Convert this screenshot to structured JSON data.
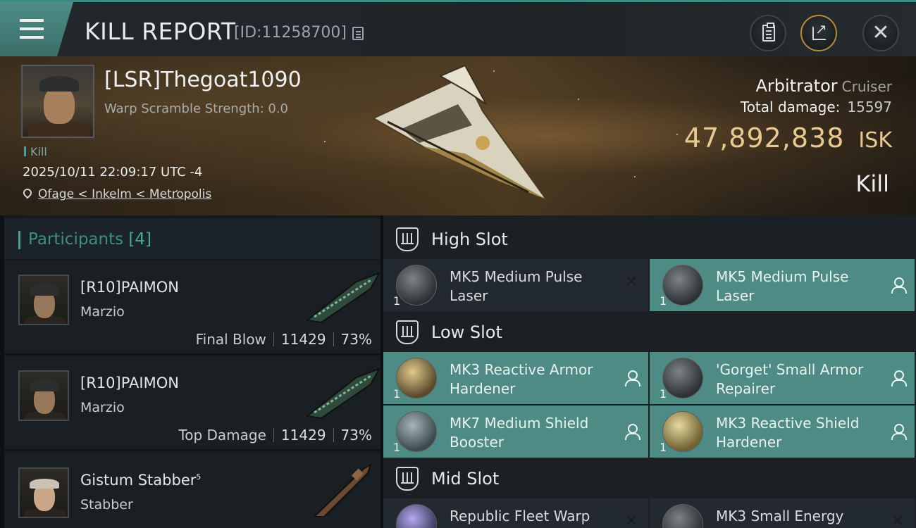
{
  "header": {
    "title": "KILL REPORT",
    "report_id": "[ID:11258700]",
    "icons": {
      "menu": "menu-icon",
      "copy": "copy-icon",
      "clipboard": "clipboard-icon",
      "share": "share-icon",
      "close": "close-icon"
    }
  },
  "victim": {
    "pilot": "[LSR]Thegoat1090",
    "warp_scramble": "Warp Scramble Strength: 0.0",
    "tag": "Kill",
    "datetime": "2025/10/11 22:09:17 UTC -4",
    "location": "Ofage < Inkelm < Metropolis",
    "ship": "Arbitrator",
    "ship_class": "Cruiser",
    "total_damage_label": "Total damage:",
    "total_damage": "15597",
    "isk_value": "47,892,838",
    "isk_unit": "ISK",
    "result": "Kill"
  },
  "participants": {
    "title": "Participants",
    "count": "[4]",
    "items": [
      {
        "name": "[R10]PAIMON",
        "ship": "Marzio",
        "label": "Final Blow",
        "damage": "11429",
        "percent": "73%"
      },
      {
        "name": "[R10]PAIMON",
        "ship": "Marzio",
        "label": "Top Damage",
        "damage": "11429",
        "percent": "73%"
      },
      {
        "name": "Gistum Stabber",
        "name_sup": "5",
        "ship": "Stabber"
      }
    ]
  },
  "slots": {
    "high": {
      "title": "High Slot",
      "modules": [
        {
          "name": "MK5 Medium Pulse Laser",
          "qty": "1",
          "status": "destroyed"
        },
        {
          "name": "MK5 Medium Pulse Laser",
          "qty": "1",
          "status": "dropped"
        }
      ]
    },
    "low": {
      "title": "Low Slot",
      "modules": [
        {
          "name": "MK3 Reactive Armor Hardener",
          "qty": "1",
          "status": "dropped"
        },
        {
          "name": "'Gorget' Small Armor Repairer",
          "qty": "1",
          "status": "dropped"
        },
        {
          "name": "MK7 Medium Shield Booster",
          "qty": "1",
          "status": "dropped"
        },
        {
          "name": "MK3 Reactive Shield Hardener",
          "qty": "1",
          "status": "dropped"
        }
      ]
    },
    "mid": {
      "title": "Mid Slot",
      "modules": [
        {
          "name": "Republic Fleet Warp",
          "qty": "1",
          "status": "destroyed"
        },
        {
          "name": "MK3 Small Energy",
          "qty": "1",
          "status": "destroyed"
        }
      ]
    }
  },
  "colors": {
    "accent": "#4aa39a",
    "dropped_bg": "#4d8b84",
    "isk": "#e8c98f"
  }
}
